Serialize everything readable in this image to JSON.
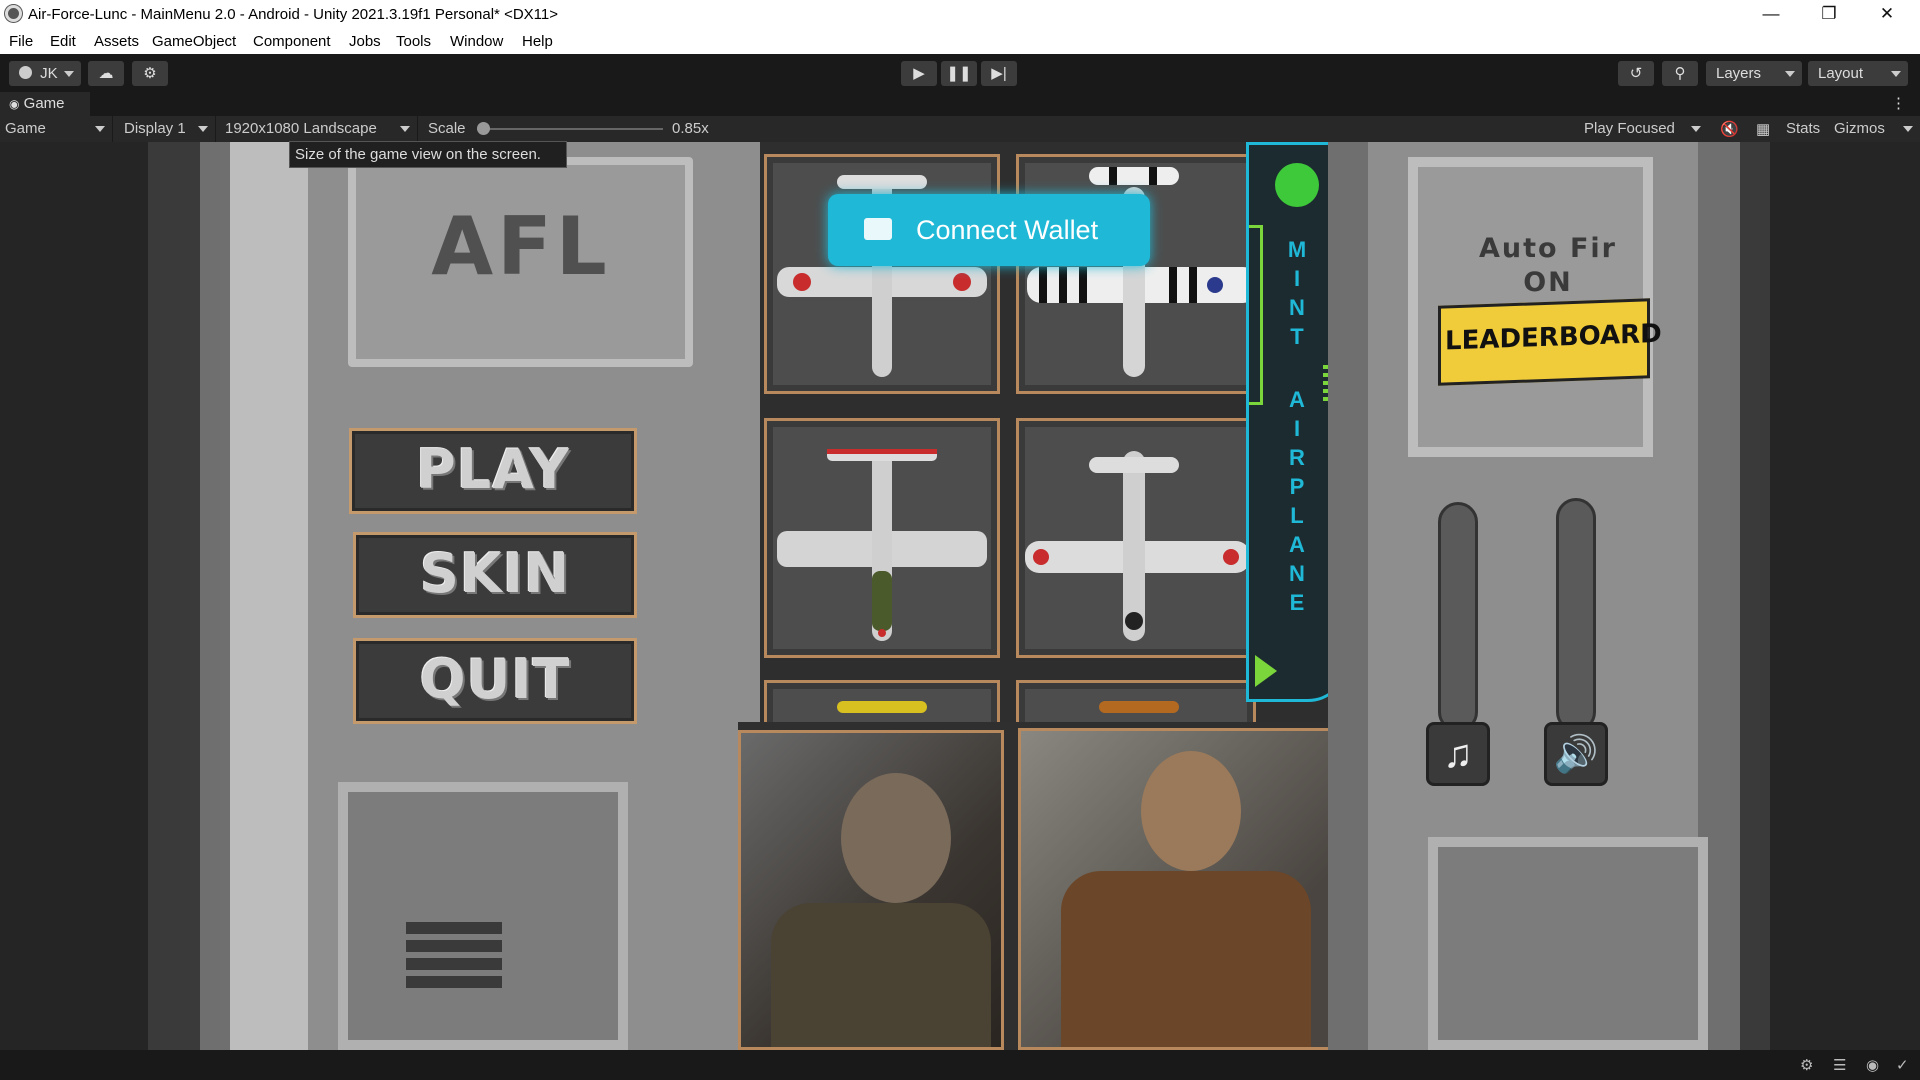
{
  "window": {
    "title": "Air-Force-Lunc - MainMenu 2.0 - Android - Unity 2021.3.19f1 Personal* <DX11>"
  },
  "menu": [
    "File",
    "Edit",
    "Assets",
    "GameObject",
    "Component",
    "Jobs",
    "Tools",
    "Window",
    "Help"
  ],
  "toolbar": {
    "account": "JK",
    "layers": "Layers",
    "layout": "Layout"
  },
  "tab": {
    "label": "Game"
  },
  "gamebar": {
    "mode": "Game",
    "display": "Display 1",
    "resolution": "1920x1080 Landscape",
    "scale_label": "Scale",
    "scale_value": "0.85x",
    "play_focused": "Play Focused",
    "stats": "Stats",
    "gizmos": "Gizmos"
  },
  "tooltip": "Size of the game view on the screen.",
  "game": {
    "logo": "AFL",
    "buttons": {
      "play": "PLAY",
      "skin": "SKIN",
      "quit": "QUIT"
    },
    "connect_wallet": "Connect Wallet",
    "mint_letters": [
      "M",
      "I",
      "N",
      "T"
    ],
    "airplane_letters": [
      "A",
      "I",
      "R",
      "P",
      "L",
      "A",
      "N",
      "E"
    ],
    "auto_fire_line1": "Auto Fir",
    "auto_fire_line2": "ON",
    "leaderboard": "LEADERBOARD",
    "colors": {
      "accent_cyan": "#1fb8d6",
      "frame_gold": "#b8895c",
      "leaderboard_yellow": "#f1cc3a",
      "neon_green": "#7ad63a"
    }
  }
}
